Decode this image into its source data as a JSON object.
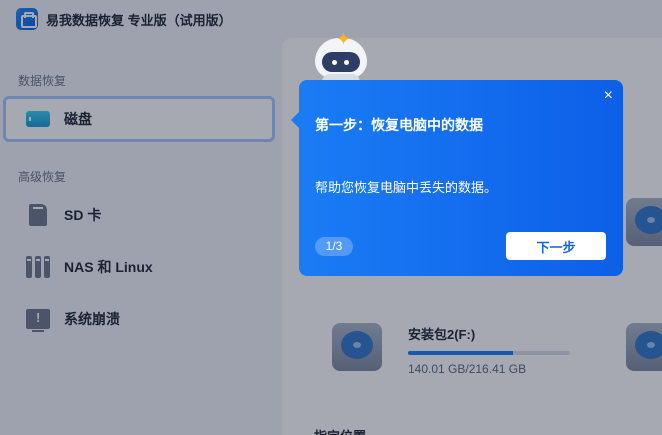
{
  "app": {
    "title": "易我数据恢复 专业版（试用版）"
  },
  "sidebar": {
    "section_recover": "数据恢复",
    "section_advanced": "高级恢复",
    "items": [
      {
        "label": "磁盘",
        "icon": "disk-icon",
        "active": true
      },
      {
        "label": "SD 卡",
        "icon": "sd-card-icon"
      },
      {
        "label": "NAS 和 Linux",
        "icon": "nas-icon"
      },
      {
        "label": "系统崩溃",
        "icon": "system-crash-icon"
      }
    ]
  },
  "main": {
    "drive": {
      "name": "安装包2(F:)",
      "size": "140.01 GB/216.41 GB",
      "used_fraction": 0.647
    },
    "section_location": "指定位置"
  },
  "tour": {
    "title": "第一步：恢复电脑中的数据",
    "body": "帮助您恢复电脑中丢失的数据。",
    "step": "1/3",
    "next_label": "下一步",
    "close": "×"
  },
  "colors": {
    "accent": "#1a7cf5",
    "tooltip_bg": "#0d6ff0",
    "active_border": "#a3c9ff"
  }
}
